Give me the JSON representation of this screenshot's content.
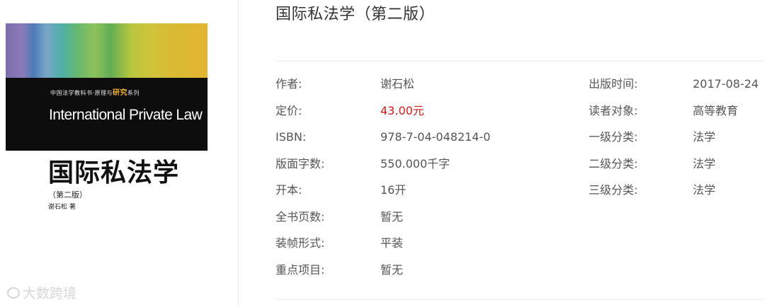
{
  "cover": {
    "series_text": "中国法学教科书·原理与",
    "series_highlight": "研究",
    "series_suffix": "系列",
    "english_title": "International Private Law",
    "chinese_title": "国际私法学",
    "edition": "（第二版）",
    "author": "谢石松  著",
    "watermark": "大数跨境"
  },
  "book": {
    "title": "国际私法学（第二版）"
  },
  "details_left": [
    {
      "label": "作者:",
      "value": "谢石松"
    },
    {
      "label": "定价:",
      "value": "43.00元"
    },
    {
      "label": "ISBN:",
      "value": "978-7-04-048214-0"
    },
    {
      "label": "版面字数:",
      "value": "550.000千字"
    },
    {
      "label": "开本:",
      "value": "16开"
    },
    {
      "label": "全书页数:",
      "value": "暂无"
    },
    {
      "label": "装帧形式:",
      "value": "平装"
    },
    {
      "label": "重点项目:",
      "value": "暂无"
    }
  ],
  "details_right": [
    {
      "label": "出版时间:",
      "value": "2017-08-24"
    },
    {
      "label": "读者对象:",
      "value": "高等教育"
    },
    {
      "label": "一级分类:",
      "value": "法学"
    },
    {
      "label": "二级分类:",
      "value": "法学"
    },
    {
      "label": "三级分类:",
      "value": "法学"
    }
  ],
  "colors": {
    "price": "#d01818",
    "label": "#555555",
    "title": "#333333"
  }
}
